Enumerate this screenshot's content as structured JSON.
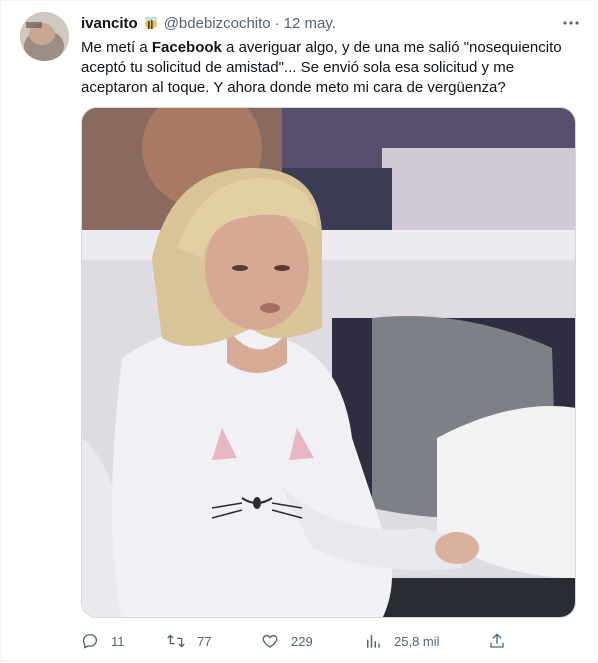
{
  "author": {
    "display_name": "ivancito",
    "badge_icon": "bee-emoji-icon",
    "handle": "@bdebizcochito",
    "separator": "·",
    "date": "12 may."
  },
  "tweet": {
    "text_part1": "Me metí a ",
    "text_bold": "Facebook",
    "text_part2": " a averiguar algo, y de una me salió \"nosequiencito aceptó tu solicitud de amistad\"... Se envió sola esa solicitud y me aceptaron al toque. Y ahora donde meto mi cara de vergüenza?"
  },
  "actions": {
    "replies": "11",
    "retweets": "77",
    "likes": "229",
    "views": "25,8 mil"
  },
  "icons": {
    "more": "more-options-icon",
    "reply": "reply-icon",
    "retweet": "retweet-icon",
    "like": "heart-icon",
    "views": "views-chart-icon",
    "share": "share-icon"
  },
  "colors": {
    "text": "#0f1419",
    "secondary": "#536471",
    "border": "#cfd9de"
  }
}
